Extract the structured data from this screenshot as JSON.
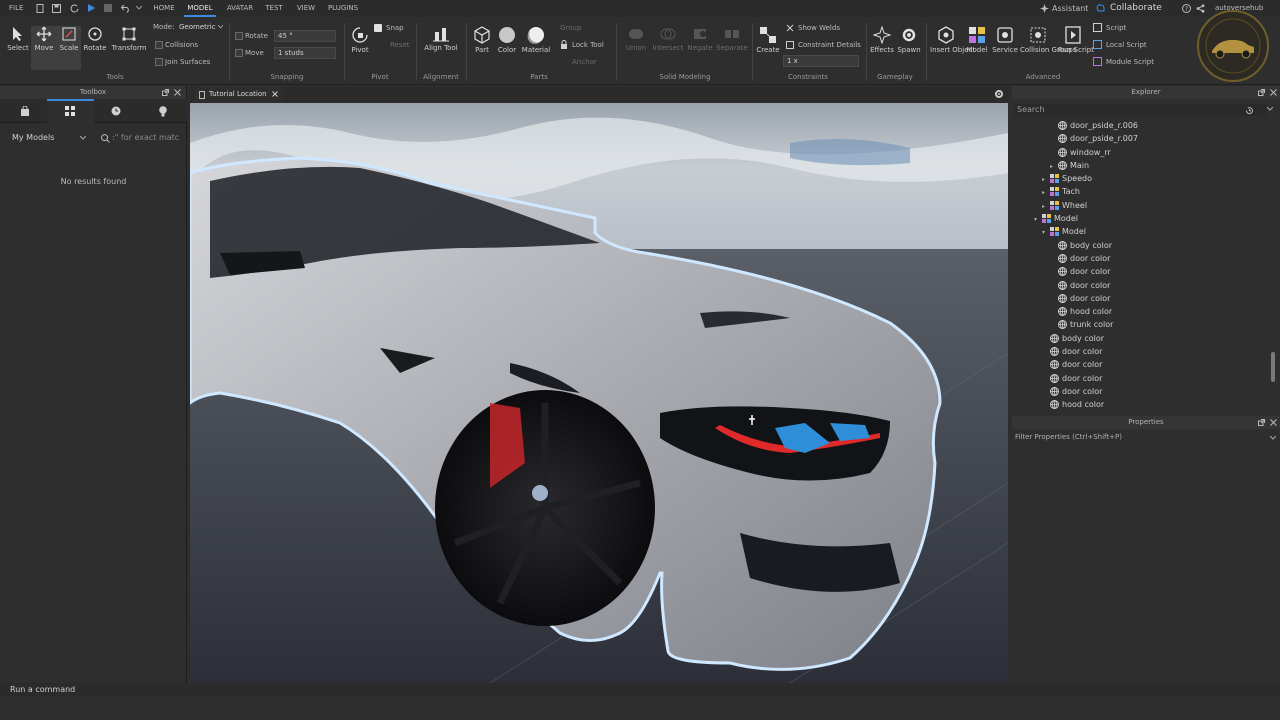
{
  "menu": {
    "file": "FILE",
    "tabs": [
      "HOME",
      "MODEL",
      "AVATAR",
      "TEST",
      "VIEW",
      "PLUGINS"
    ],
    "active_tab": "MODEL",
    "assistant": "Assistant",
    "collaborate": "Collaborate",
    "user": "autoversehub"
  },
  "ribbon": {
    "tools": {
      "select": "Select",
      "move": "Move",
      "scale": "Scale",
      "rotate": "Rotate",
      "transform": "Transform",
      "mode_label": "Mode:",
      "mode_value": "Geometric",
      "collisions": "Collisions",
      "join_surfaces": "Join Surfaces",
      "group": "Tools"
    },
    "snapping": {
      "rotate_label": "Rotate",
      "rotate_value": "45 °",
      "move_label": "Move",
      "move_value": "1 studs",
      "group": "Snapping"
    },
    "pivot": {
      "pivot": "Pivot",
      "snap": "Snap",
      "reset": "Reset",
      "group": "Pivot"
    },
    "alignment": {
      "align_tool": "Align Tool",
      "group": "Alignment"
    },
    "parts": {
      "part": "Part",
      "color": "Color",
      "material": "Material",
      "group_btn": "Group",
      "lock_tool": "Lock Tool",
      "anchor": "Anchor",
      "group": "Parts"
    },
    "solid": {
      "union": "Union",
      "intersect": "Intersect",
      "negate": "Negate",
      "separate": "Separate",
      "group": "Solid Modeling"
    },
    "constraints": {
      "create": "Create",
      "show_welds": "Show Welds",
      "constraint_details": "Constraint Details",
      "scale_value": "1 x",
      "group": "Constraints"
    },
    "gameplay": {
      "effects": "Effects",
      "spawn": "Spawn",
      "group": "Gameplay"
    },
    "advanced": {
      "insert_object": "Insert Object",
      "model": "Model",
      "service": "Service",
      "collision_groups": "Collision Groups",
      "run_script": "Run Script",
      "script": "Script",
      "local_script": "Local Script",
      "module_script": "Module Script",
      "group": "Advanced"
    }
  },
  "toolbox": {
    "title": "Toolbox",
    "dropdown": "My Models",
    "search_placeholder": ":\" for exact matc",
    "empty": "No results found"
  },
  "viewport": {
    "tab": "Tutorial Location"
  },
  "explorer": {
    "title": "Explorer",
    "search_placeholder": "Search",
    "items": [
      {
        "label": "door_pside_r.006",
        "kind": "mesh",
        "indent": 3
      },
      {
        "label": "door_pside_r.007",
        "kind": "mesh",
        "indent": 3
      },
      {
        "label": "window_rr",
        "kind": "mesh",
        "indent": 3
      },
      {
        "label": "Main",
        "kind": "mesh",
        "indent": 3,
        "caret": "▸"
      },
      {
        "label": "Speedo",
        "kind": "model",
        "indent": 2,
        "caret": "▸"
      },
      {
        "label": "Tach",
        "kind": "model",
        "indent": 2,
        "caret": "▸"
      },
      {
        "label": "Wheel",
        "kind": "model",
        "indent": 2,
        "caret": "▸"
      },
      {
        "label": "Model",
        "kind": "model",
        "indent": 1,
        "caret": "▾"
      },
      {
        "label": "Model",
        "kind": "model",
        "indent": 2,
        "caret": "▾"
      },
      {
        "label": "body color",
        "kind": "mesh",
        "indent": 3
      },
      {
        "label": "door color",
        "kind": "mesh",
        "indent": 3
      },
      {
        "label": "door color",
        "kind": "mesh",
        "indent": 3
      },
      {
        "label": "door color",
        "kind": "mesh",
        "indent": 3
      },
      {
        "label": "door color",
        "kind": "mesh",
        "indent": 3
      },
      {
        "label": "hood color",
        "kind": "mesh",
        "indent": 3
      },
      {
        "label": "trunk color",
        "kind": "mesh",
        "indent": 3
      },
      {
        "label": "body color",
        "kind": "mesh",
        "indent": 2
      },
      {
        "label": "door color",
        "kind": "mesh",
        "indent": 2
      },
      {
        "label": "door color",
        "kind": "mesh",
        "indent": 2
      },
      {
        "label": "door color",
        "kind": "mesh",
        "indent": 2
      },
      {
        "label": "door color",
        "kind": "mesh",
        "indent": 2
      },
      {
        "label": "hood color",
        "kind": "mesh",
        "indent": 2
      }
    ]
  },
  "properties": {
    "title": "Properties",
    "filter_placeholder": "Filter Properties (Ctrl+Shift+P)"
  },
  "command": {
    "placeholder": "Run a command"
  },
  "colors": {
    "accent": "#3b8be0",
    "selection_outline": "#cfe8ff"
  }
}
